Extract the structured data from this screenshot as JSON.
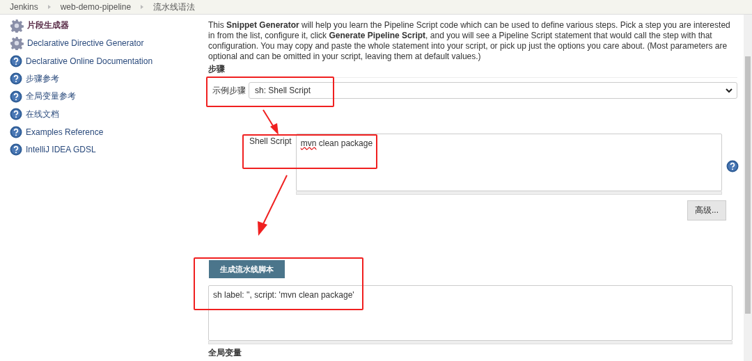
{
  "breadcrumbs": [
    "Jenkins",
    "web-demo-pipeline",
    "流水线语法"
  ],
  "sidebar": {
    "items": [
      {
        "label": "片段生成器",
        "kind": "tool",
        "selected": true
      },
      {
        "label": "Declarative Directive Generator",
        "kind": "tool",
        "selected": false
      },
      {
        "label": "Declarative Online Documentation",
        "kind": "doc",
        "selected": false
      },
      {
        "label": "步骤参考",
        "kind": "doc",
        "selected": false
      },
      {
        "label": "全局变量参考",
        "kind": "doc",
        "selected": false
      },
      {
        "label": "在线文档",
        "kind": "doc",
        "selected": false
      },
      {
        "label": "Examples Reference",
        "kind": "doc",
        "selected": false
      },
      {
        "label": "IntelliJ IDEA GDSL",
        "kind": "doc",
        "selected": false
      }
    ]
  },
  "intro": "This **Snippet Generator** will help you learn the Pipeline Script code which can be used to define various steps. Pick a step you are interested in from the list, configure it, click **Generate Pipeline Script**, and you will see a Pipeline Script statement that would call the step with that configuration. You may copy and paste the whole statement into your script, or pick up just the options you care about. (Most parameters are optional and can be omitted in your script, leaving them at default values.)",
  "steps_heading": "步骤",
  "sample_step": {
    "label": "示例步骤",
    "value": "sh: Shell Script"
  },
  "shell_script": {
    "label": "Shell Script",
    "value": "mvn clean package"
  },
  "advanced_button": "高级...",
  "generate_button": "生成流水线脚本",
  "output": "sh label: '', script: 'mvn clean package'",
  "globals_heading": "全局变量"
}
